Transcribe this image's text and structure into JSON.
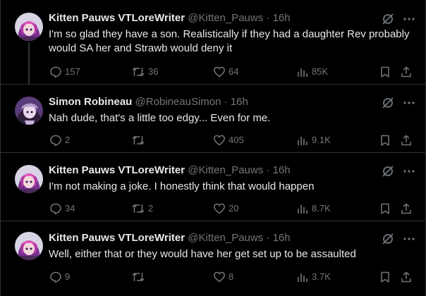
{
  "colors": {
    "background": "#000000",
    "text": "#e7e9ea",
    "muted": "#71767b",
    "divider": "#2f3336"
  },
  "posts": [
    {
      "display_name": "Kitten Pauws VTLoreWriter",
      "handle": "@Kitten_Pauws",
      "separator": "·",
      "time": "16h",
      "text": "I'm so glad they have a son. Realistically if they had a daughter Rev probably would SA her and Strawb would deny it",
      "replies": "157",
      "reposts": "36",
      "likes": "64",
      "views": "85K",
      "avatar_icon": "pink-haired-character-avatar"
    },
    {
      "display_name": "Simon Robineau",
      "handle": "@RobineauSimon",
      "separator": "·",
      "time": "16h",
      "text": "Nah dude, that's a little too edgy... Even for me.",
      "replies": "2",
      "reposts": "",
      "likes": "405",
      "views": "9.1K",
      "avatar_icon": "purple-character-avatar"
    },
    {
      "display_name": "Kitten Pauws VTLoreWriter",
      "handle": "@Kitten_Pauws",
      "separator": "·",
      "time": "16h",
      "text": "I'm not making a joke. I honestly think that would happen",
      "replies": "34",
      "reposts": "2",
      "likes": "20",
      "views": "8.7K",
      "avatar_icon": "pink-haired-character-avatar"
    },
    {
      "display_name": "Kitten Pauws VTLoreWriter",
      "handle": "@Kitten_Pauws",
      "separator": "·",
      "time": "16h",
      "text": "Well, either that or they would have her get set up to be assaulted",
      "replies": "9",
      "reposts": "",
      "likes": "8",
      "views": "3.7K",
      "avatar_icon": "pink-haired-character-avatar"
    }
  ]
}
